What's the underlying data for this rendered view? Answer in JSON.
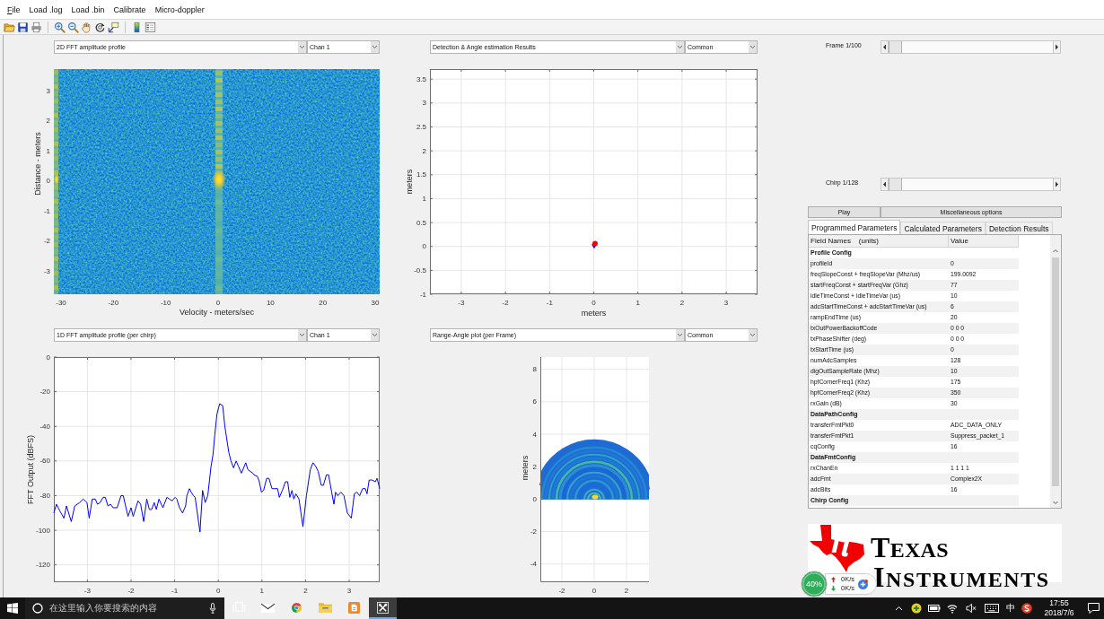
{
  "menu_bar": {
    "items": [
      {
        "label": "File",
        "mnemonic_underlined": true
      },
      {
        "label": "Load .log",
        "mnemonic_underlined": false
      },
      {
        "label": "Load .bin",
        "mnemonic_underlined": false
      },
      {
        "label": "Calibrate",
        "mnemonic_underlined": false
      },
      {
        "label": "Micro-doppler",
        "mnemonic_underlined": false
      }
    ]
  },
  "plots": [
    {
      "kind": "heatmap",
      "view_select": "2D FFT amplitude profile",
      "channel_select": "Chan 1",
      "xlabel": "Velocity - meters/sec",
      "ylabel": "Distance - meters",
      "xticks": [
        "-30",
        "-20",
        "-10",
        "0",
        "10",
        "20",
        "30"
      ],
      "yticks": [
        "3",
        "2",
        "1",
        "0",
        "-1",
        "-2",
        "-3"
      ]
    },
    {
      "kind": "scatter",
      "view_select": "Detection & Angle estimation Results",
      "channel_select": "Common",
      "chart_data": {
        "type": "scatter",
        "xlabel": "meters",
        "ylabel": "meters",
        "x": [
          0.03,
          0.01
        ],
        "series": [
          {
            "color": "#ff0000",
            "values": [
              0.06,
              null
            ]
          },
          {
            "color": "#0000ff",
            "values": [
              null,
              0.01
            ]
          }
        ],
        "xlim": [
          -3.71,
          3.71
        ],
        "ylim": [
          -1,
          3.71
        ],
        "xticks": [
          -3,
          -2,
          -1,
          0,
          1,
          2,
          3
        ],
        "yticks": [
          -1,
          -0.5,
          0,
          0.5,
          1,
          1.5,
          2,
          2.5,
          3,
          3.5
        ],
        "grid": true
      }
    },
    {
      "kind": "line",
      "view_select": "1D FFT amplitude profile (per chirp)",
      "channel_select": "Chan 1",
      "chart_data": {
        "type": "line",
        "ylabel": "FFT Output (dBFS)",
        "x": [
          -3.77,
          -3.71,
          -3.63,
          -3.54,
          -3.48,
          -3.37,
          -3.29,
          -3.18,
          -3.1,
          -3.01,
          -2.96,
          -2.89,
          -2.82,
          -2.77,
          -2.71,
          -2.64,
          -2.59,
          -2.53,
          -2.47,
          -2.41,
          -2.32,
          -2.23,
          -2.18,
          -2.07,
          -2.0,
          -1.95,
          -1.84,
          -1.78,
          -1.71,
          -1.64,
          -1.58,
          -1.53,
          -1.47,
          -1.42,
          -1.36,
          -1.27,
          -1.18,
          -1.12,
          -1.06,
          -0.99,
          -0.95,
          -0.89,
          -0.82,
          -0.75,
          -0.72,
          -0.66,
          -0.62,
          -0.57,
          -0.53,
          -0.42,
          -0.36,
          -0.3,
          -0.24,
          -0.17,
          -0.12,
          -0.08,
          -0.03,
          0.03,
          0.1,
          0.15,
          0.24,
          0.29,
          0.35,
          0.41,
          0.46,
          0.53,
          0.63,
          0.68,
          0.79,
          0.82,
          0.9,
          0.94,
          0.99,
          1.04,
          1.11,
          1.16,
          1.23,
          1.29,
          1.36,
          1.4,
          1.47,
          1.54,
          1.59,
          1.64,
          1.69,
          1.73,
          1.78,
          1.85,
          1.94,
          2.02,
          2.11,
          2.17,
          2.23,
          2.29,
          2.36,
          2.41,
          2.48,
          2.53,
          2.6,
          2.65,
          2.69,
          2.74,
          2.81,
          2.88,
          2.96,
          3.05,
          3.12,
          3.18,
          3.24,
          3.31,
          3.37,
          3.41,
          3.46,
          3.53,
          3.6,
          3.64,
          3.7
        ],
        "series": [
          {
            "color": "#0000ff",
            "values": [
              -90,
              -85,
              -89,
              -93,
              -86,
              -95,
              -86,
              -84,
              -82,
              -84,
              -93,
              -82,
              -82,
              -85,
              -84,
              -81,
              -81,
              -86,
              -85,
              -87,
              -87,
              -80,
              -80,
              -92,
              -87,
              -92,
              -83,
              -85,
              -95,
              -82,
              -88,
              -88,
              -84,
              -88,
              -82,
              -87,
              -81,
              -82,
              -83,
              -81,
              -82,
              -87,
              -90,
              -86,
              -80,
              -76,
              -78,
              -80,
              -81,
              -101,
              -77,
              -84,
              -80,
              -64,
              -56,
              -45,
              -33,
              -27,
              -28,
              -40,
              -55,
              -60,
              -64,
              -60,
              -63,
              -67,
              -61,
              -65,
              -67,
              -68,
              -69,
              -72,
              -78,
              -77,
              -70,
              -70,
              -76,
              -76,
              -76,
              -81,
              -77,
              -72,
              -72,
              -81,
              -77,
              -82,
              -79,
              -82,
              -98,
              -80,
              -65,
              -61,
              -63,
              -66,
              -74,
              -74,
              -68,
              -68,
              -78,
              -85,
              -78,
              -80,
              -78,
              -80,
              -90,
              -93,
              -79,
              -78,
              -80,
              -76,
              -76,
              -79,
              -71,
              -71,
              -72,
              -70,
              -76
            ]
          }
        ],
        "xlim": [
          -3.77,
          3.7
        ],
        "ylim": [
          -130,
          0
        ],
        "xticks": [
          -3,
          -2,
          -1,
          0,
          1,
          2,
          3
        ],
        "yticks": [
          0,
          -20,
          -40,
          -60,
          -80,
          -100,
          -120
        ],
        "grid": true
      }
    },
    {
      "kind": "polar",
      "view_select": "Range-Angle plot (per Frame)",
      "channel_select": "Common",
      "ylabel": "meters",
      "xticks": [
        "-2",
        "0",
        "2"
      ],
      "yticks": [
        "8",
        "6",
        "4",
        "2",
        "0",
        "-2",
        "-4"
      ]
    }
  ],
  "controls": {
    "frame": {
      "label": "Frame 1/100",
      "level": 0
    },
    "chirp": {
      "label": "Chirp 1/128",
      "level": 0
    },
    "buttons": [
      "Play",
      "Miscellaneous options"
    ],
    "tabs": [
      {
        "label": "Programmed Parameters",
        "selected": true
      },
      {
        "label": "Calculated Parameters",
        "selected": false
      },
      {
        "label": "Detection Results",
        "selected": false
      }
    ],
    "table": {
      "columns": [
        "Field Names    (units)",
        "Value"
      ],
      "rows": [
        {
          "kind": "section",
          "name": "Profile Config"
        },
        {
          "kind": "field",
          "name": "profileId",
          "value": "0"
        },
        {
          "kind": "field",
          "name": "freqSlopeConst + freqSlopeVar (Mhz/us)",
          "value": "199.0092"
        },
        {
          "kind": "field",
          "name": "startFreqConst + startFreqVar (Ghz)",
          "value": "77"
        },
        {
          "kind": "field",
          "name": "idleTimeConst + idleTimeVar (us)",
          "value": "10"
        },
        {
          "kind": "field",
          "name": "adcStartTimeConst + adcStartTimeVar (us)",
          "value": "6"
        },
        {
          "kind": "field",
          "name": "rampEndTime (us)",
          "value": "20"
        },
        {
          "kind": "field",
          "name": "txOutPowerBackoffCode",
          "value": "0 0 0"
        },
        {
          "kind": "field",
          "name": "txPhaseShifter (deg)",
          "value": "0 0 0"
        },
        {
          "kind": "field",
          "name": "txStartTime (us)",
          "value": "0"
        },
        {
          "kind": "field",
          "name": "numAdcSamples",
          "value": "128"
        },
        {
          "kind": "field",
          "name": "digOutSampleRate (Mhz)",
          "value": "10"
        },
        {
          "kind": "field",
          "name": "hpfCornerFreq1 (Khz)",
          "value": "175"
        },
        {
          "kind": "field",
          "name": "hpfCornerFreq2 (Khz)",
          "value": "350"
        },
        {
          "kind": "field",
          "name": "rxGain (dB)",
          "value": "30"
        },
        {
          "kind": "section",
          "name": "DataPathConfig"
        },
        {
          "kind": "field",
          "name": "transferFmtPkt0",
          "value": "ADC_DATA_ONLY"
        },
        {
          "kind": "field",
          "name": "transferFmtPkt1",
          "value": "Suppress_packet_1"
        },
        {
          "kind": "field",
          "name": "cqConfig",
          "value": "16"
        },
        {
          "kind": "section",
          "name": "DataFmtConfig"
        },
        {
          "kind": "field",
          "name": "rxChanEn",
          "value": "1 1 1 1"
        },
        {
          "kind": "field",
          "name": "adcFmt",
          "value": "Complex2X"
        },
        {
          "kind": "field",
          "name": "adcBits",
          "value": "16"
        },
        {
          "kind": "section",
          "name": "Chirp Config"
        }
      ]
    }
  },
  "logo": {
    "line1": "TEXAS",
    "line2": "INSTRUMENTS"
  },
  "network_widget": {
    "load": "40%",
    "upload": "0K/s",
    "download": "0K/s"
  },
  "taskbar": {
    "search": {
      "placeholder": "在这里输入你要搜索的内容"
    },
    "apps": [
      {
        "kind": "taskview",
        "active": false
      },
      {
        "kind": "mail",
        "active": false
      },
      {
        "kind": "browser",
        "active": false
      },
      {
        "kind": "folder",
        "active": false
      },
      {
        "kind": "document",
        "active": false
      },
      {
        "kind": "tools",
        "active": true
      }
    ],
    "ime": "中",
    "time": "17:55",
    "date": "2018/7/6"
  }
}
